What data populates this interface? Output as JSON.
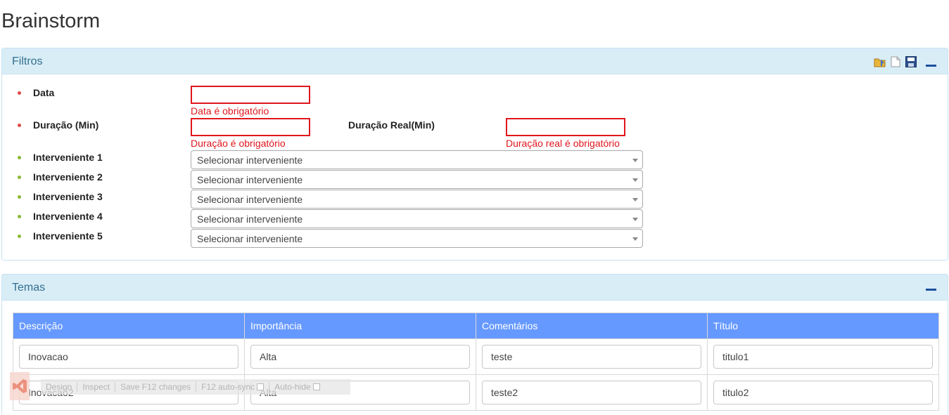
{
  "page": {
    "title": "Brainstorm"
  },
  "filtros": {
    "title": "Filtros",
    "tools": [
      "open-folder-icon",
      "new-document-icon",
      "save-disk-icon",
      "collapse-icon"
    ],
    "data_label": "Data",
    "data_value": "",
    "data_error": "Data é obrigatório",
    "duracao_label": "Duração (Min)",
    "duracao_value": "",
    "duracao_error": "Duração é obrigatório",
    "duracao_real_label": "Duração Real(Min)",
    "duracao_real_value": "",
    "duracao_real_error": "Duração real é obrigatório",
    "intervenientes": [
      {
        "label": "Interveniente 1",
        "selected": "Selecionar interveniente"
      },
      {
        "label": "Interveniente 2",
        "selected": "Selecionar interveniente"
      },
      {
        "label": "Interveniente 3",
        "selected": "Selecionar interveniente"
      },
      {
        "label": "Interveniente 4",
        "selected": "Selecionar interveniente"
      },
      {
        "label": "Interveniente 5",
        "selected": "Selecionar interveniente"
      }
    ]
  },
  "temas": {
    "title": "Temas",
    "columns": [
      "Descrição",
      "Importância",
      "Comentários",
      "Título"
    ],
    "rows": [
      [
        "Inovacao",
        "Alta",
        "teste",
        "titulo1"
      ],
      [
        "Inovacao2",
        "Alta",
        "teste2",
        "titulo2"
      ]
    ]
  },
  "devtools": {
    "items": [
      "Design",
      "Inspect",
      "Save F12 changes",
      "F12 auto-sync",
      "Auto-hide"
    ]
  },
  "colors": {
    "panel_heading": "#d9edf7",
    "panel_title": "#31708f",
    "error": "#e0161d",
    "table_header": "#6699ff",
    "required_bullet": "#e24a4a",
    "optional_bullet": "#8ab933"
  }
}
